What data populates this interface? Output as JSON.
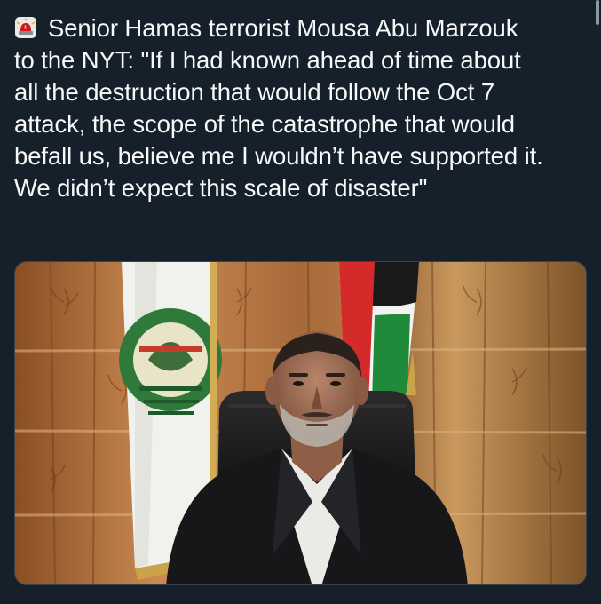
{
  "tweet": {
    "siren_icon": "police-car-light-icon",
    "text": "Senior Hamas terrorist Mousa Abu Marzouk\nto the NYT: \"If I had known ahead of time about\nall the destruction that would follow the Oct 7\nattack, the scope of the catastrophe that would\nbefall us, believe me I wouldn’t have supported it.\nWe didn’t expect this scale of disaster\""
  },
  "colors": {
    "background": "#15202b",
    "text": "#f7f9f9",
    "border": "#38444d"
  },
  "media": {
    "image": "photo-of-man-in-suit-in-front-of-curtains-and-flags"
  }
}
